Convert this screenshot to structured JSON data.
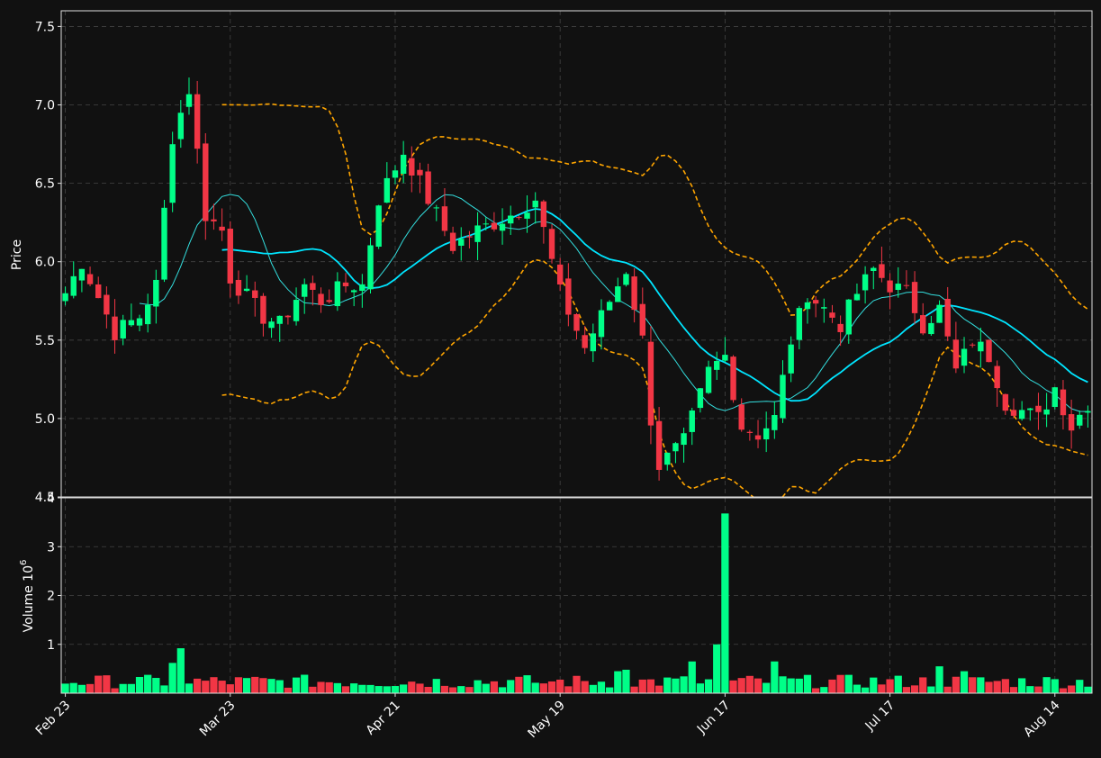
{
  "colors": {
    "background": "#111111",
    "up": "#00ff88",
    "down": "#f23645",
    "ma_fast": "#33dddd",
    "ma_slow": "#00e5ff",
    "band": "#ffa500",
    "grid": "#444444",
    "axis": "#dddddd"
  },
  "chart_data": {
    "type": "candlestick",
    "xlabel": "",
    "ylabel": "Price",
    "volume_label": "Volume  10",
    "volume_exponent": "6",
    "price_ylim": [
      4.5,
      7.6
    ],
    "price_ticks": [
      "4.5",
      "5.0",
      "5.5",
      "6.0",
      "6.5",
      "7.0",
      "7.5"
    ],
    "volume_ylim": [
      0,
      4
    ],
    "volume_ticks": [
      "1",
      "2",
      "3",
      "4"
    ],
    "x_ticks": [
      {
        "label": "Feb 23",
        "index": 0
      },
      {
        "label": "Mar 23",
        "index": 20
      },
      {
        "label": "Apr 21",
        "index": 40
      },
      {
        "label": "May 19",
        "index": 60
      },
      {
        "label": "Jun 17",
        "index": 80
      },
      {
        "label": "Jul 17",
        "index": 100
      },
      {
        "label": "Aug 14",
        "index": 120
      }
    ],
    "n_days": 125,
    "anchors": [
      [
        0,
        5.8
      ],
      [
        2,
        6.0
      ],
      [
        6,
        5.55
      ],
      [
        9,
        5.65
      ],
      [
        11,
        5.85
      ],
      [
        13,
        6.8
      ],
      [
        15,
        7.1
      ],
      [
        17,
        6.3
      ],
      [
        19,
        6.2
      ],
      [
        20,
        5.9
      ],
      [
        24,
        5.65
      ],
      [
        26,
        5.6
      ],
      [
        29,
        5.85
      ],
      [
        31,
        5.75
      ],
      [
        34,
        5.85
      ],
      [
        36,
        5.85
      ],
      [
        38,
        6.4
      ],
      [
        41,
        6.7
      ],
      [
        44,
        6.4
      ],
      [
        47,
        6.1
      ],
      [
        50,
        6.2
      ],
      [
        54,
        6.3
      ],
      [
        57,
        6.4
      ],
      [
        60,
        5.8
      ],
      [
        63,
        5.45
      ],
      [
        66,
        5.75
      ],
      [
        68,
        5.95
      ],
      [
        70,
        5.5
      ],
      [
        71,
        5.0
      ],
      [
        72,
        4.7
      ],
      [
        75,
        4.85
      ],
      [
        78,
        5.3
      ],
      [
        80,
        5.4
      ],
      [
        82,
        4.95
      ],
      [
        84,
        4.9
      ],
      [
        86,
        5.0
      ],
      [
        88,
        5.5
      ],
      [
        90,
        5.8
      ],
      [
        92,
        5.7
      ],
      [
        94,
        5.6
      ],
      [
        96,
        5.8
      ],
      [
        98,
        5.95
      ],
      [
        100,
        5.85
      ],
      [
        102,
        5.8
      ],
      [
        104,
        5.6
      ],
      [
        106,
        5.7
      ],
      [
        108,
        5.3
      ],
      [
        110,
        5.5
      ],
      [
        112,
        5.4
      ],
      [
        114,
        5.1
      ],
      [
        116,
        5.05
      ],
      [
        118,
        5.0
      ],
      [
        120,
        5.2
      ],
      [
        122,
        4.95
      ],
      [
        124,
        5.1
      ]
    ],
    "volume_spikes": {
      "13": 0.62,
      "14": 0.92,
      "79": 1.0,
      "80": 3.68,
      "67": 0.45,
      "68": 0.48,
      "76": 0.65,
      "86": 0.65,
      "106": 0.55,
      "109": 0.45,
      "58": 0.2
    },
    "ma_fast_window": 10,
    "ma_slow_window": 20,
    "band_std": 2
  }
}
